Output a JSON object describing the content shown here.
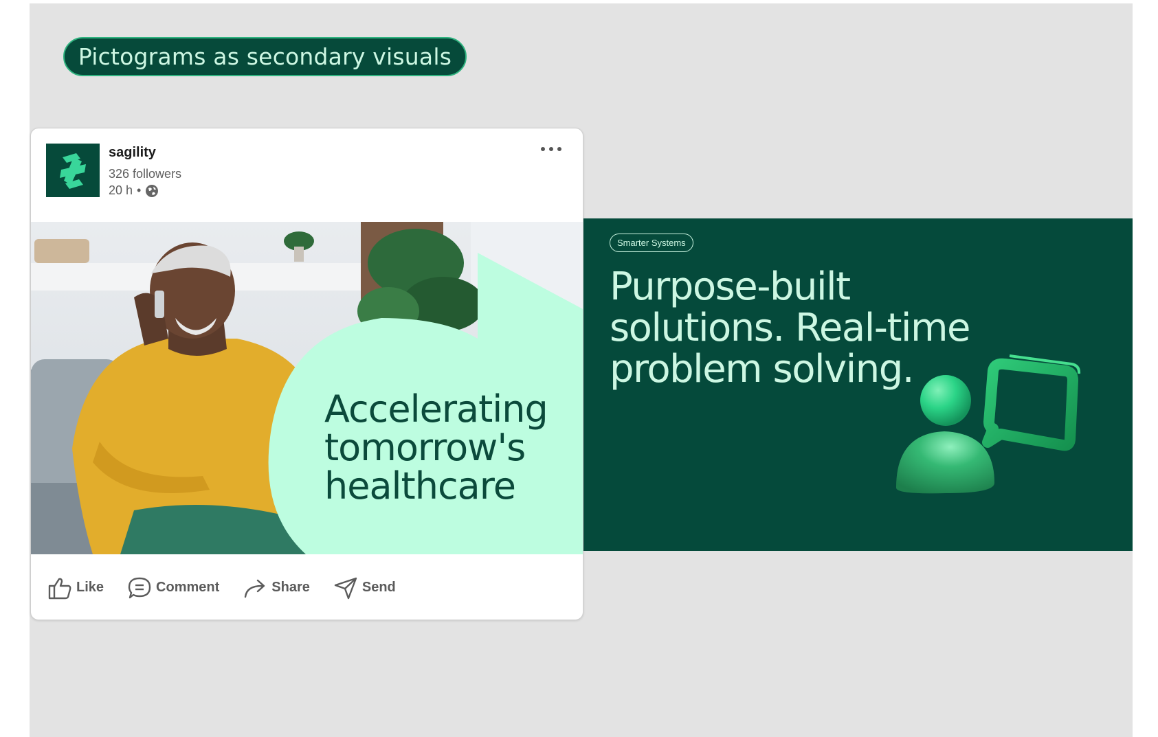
{
  "pill_title": "Pictograms as secondary visuals",
  "post": {
    "company": "sagility",
    "followers": "326 followers",
    "time": "20 h",
    "separator": "•",
    "image_headline": [
      "Accelerating",
      "tomorrow's",
      "healthcare"
    ],
    "actions": [
      {
        "label": "Like",
        "icon": "thumbs-up-icon"
      },
      {
        "label": "Comment",
        "icon": "comment-icon"
      },
      {
        "label": "Share",
        "icon": "share-arrow-icon"
      },
      {
        "label": "Send",
        "icon": "send-icon"
      }
    ]
  },
  "panel": {
    "tag": "Smarter Systems",
    "headline": [
      "Purpose-built",
      "solutions. Real-time",
      "problem solving."
    ]
  },
  "colors": {
    "brand_dark_green": "#064a3a",
    "mint": "#bdfde0",
    "accent_green": "#2fb37f",
    "background_gray": "#e3e3e3"
  }
}
